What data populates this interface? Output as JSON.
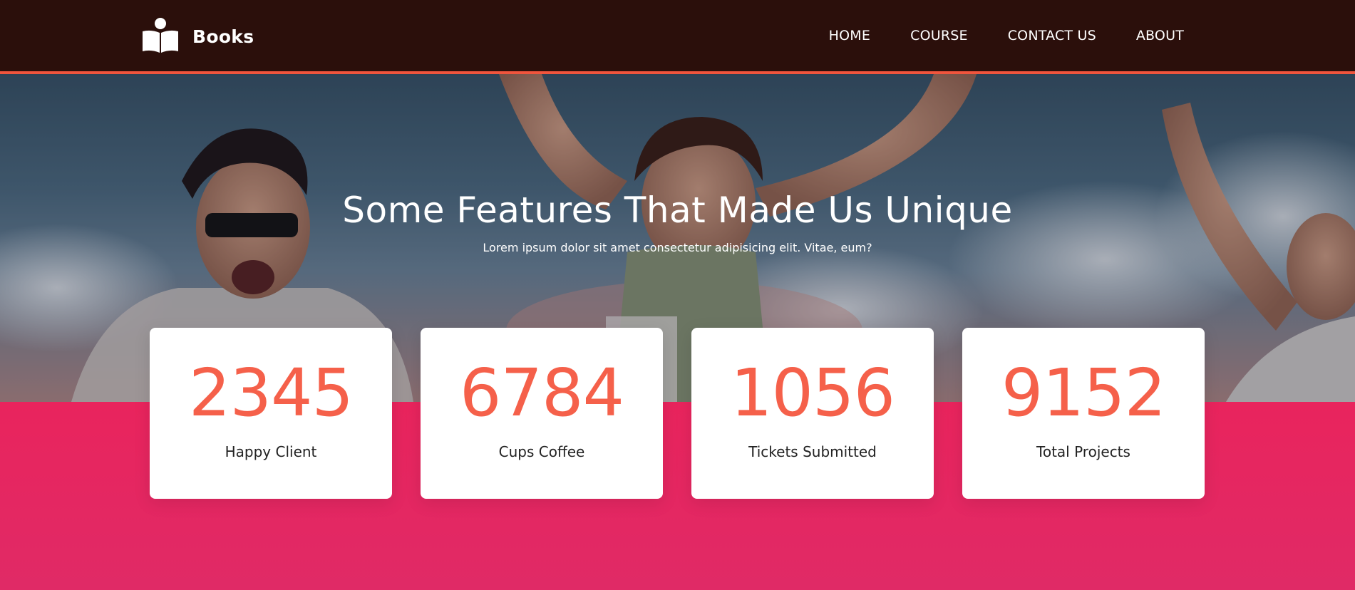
{
  "header": {
    "brand": "Books",
    "logo_icon": "book-reader-icon",
    "nav": [
      {
        "label": "HOME"
      },
      {
        "label": "COURSE"
      },
      {
        "label": "CONTACT US"
      },
      {
        "label": "ABOUT"
      }
    ]
  },
  "hero": {
    "title": "Some Features That Made Us Unique",
    "subtitle": "Lorem ipsum dolor sit amet consectetur adipisicing elit. Vitae, eum?"
  },
  "stats": [
    {
      "value": "2345",
      "label": "Happy Client"
    },
    {
      "value": "6784",
      "label": "Cups Coffee"
    },
    {
      "value": "1056",
      "label": "Tickets Submitted"
    },
    {
      "value": "9152",
      "label": "Total Projects"
    }
  ],
  "colors": {
    "header_bg": "#2b0f0b",
    "accent": "#f0553d",
    "number": "#f5604a",
    "band": "#e9245d"
  }
}
